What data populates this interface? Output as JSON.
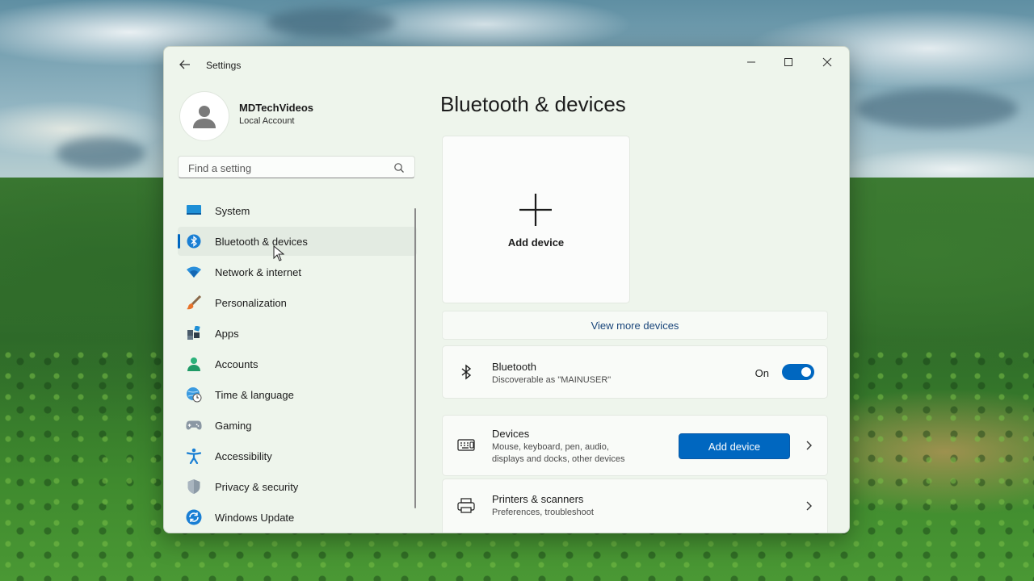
{
  "window": {
    "title": "Settings",
    "controls": [
      "minimize",
      "maximize",
      "close"
    ]
  },
  "user": {
    "name": "MDTechVideos",
    "account_type": "Local Account"
  },
  "search": {
    "placeholder": "Find a setting"
  },
  "sidebar": {
    "items": [
      {
        "label": "System",
        "icon": "monitor-icon",
        "active": false
      },
      {
        "label": "Bluetooth & devices",
        "icon": "bluetooth-icon",
        "active": true
      },
      {
        "label": "Network & internet",
        "icon": "wifi-icon",
        "active": false
      },
      {
        "label": "Personalization",
        "icon": "brush-icon",
        "active": false
      },
      {
        "label": "Apps",
        "icon": "apps-icon",
        "active": false
      },
      {
        "label": "Accounts",
        "icon": "person-icon",
        "active": false
      },
      {
        "label": "Time & language",
        "icon": "globe-clock-icon",
        "active": false
      },
      {
        "label": "Gaming",
        "icon": "gamepad-icon",
        "active": false
      },
      {
        "label": "Accessibility",
        "icon": "accessibility-icon",
        "active": false
      },
      {
        "label": "Privacy & security",
        "icon": "shield-icon",
        "active": false
      },
      {
        "label": "Windows Update",
        "icon": "update-icon",
        "active": false
      }
    ]
  },
  "main": {
    "title": "Bluetooth & devices",
    "add_tile_label": "Add device",
    "view_more": "View more devices",
    "bluetooth": {
      "title": "Bluetooth",
      "subtitle": "Discoverable as \"MAINUSER\"",
      "state_label": "On",
      "enabled": true
    },
    "devices": {
      "title": "Devices",
      "subtitle_line1": "Mouse, keyboard, pen, audio,",
      "subtitle_line2": "displays and docks, other devices",
      "button_label": "Add device"
    },
    "printers": {
      "title": "Printers & scanners",
      "subtitle": "Preferences, troubleshoot"
    }
  },
  "colors": {
    "accent": "#0067c0",
    "window_bg": "#eef5ec"
  }
}
